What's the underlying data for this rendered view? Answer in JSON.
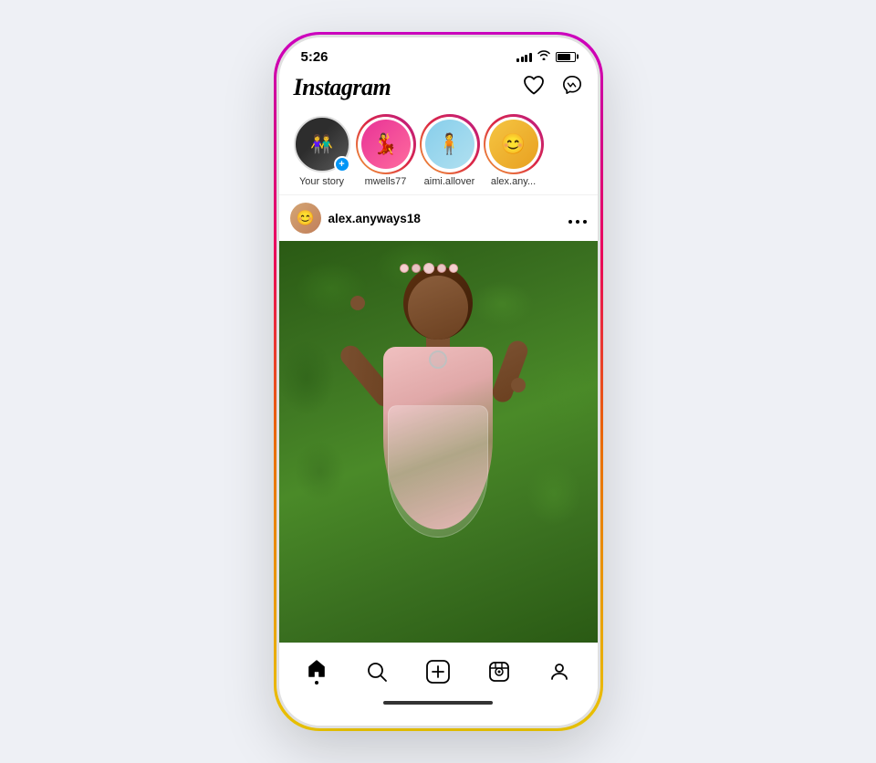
{
  "phone": {
    "status": {
      "time": "5:26"
    }
  },
  "header": {
    "logo": "Instagram",
    "heart_icon": "♡",
    "messenger_icon": "✉"
  },
  "stories": [
    {
      "id": "your-story",
      "label": "Your story",
      "has_add": true
    },
    {
      "id": "mwells77",
      "label": "mwells77",
      "has_add": false
    },
    {
      "id": "aimi-allover",
      "label": "aimi.allover",
      "has_add": false
    },
    {
      "id": "alex-anyways",
      "label": "alex.any...",
      "has_add": false
    }
  ],
  "post": {
    "username": "alex.anyways18",
    "options_icon": "···"
  },
  "nav": {
    "items": [
      {
        "id": "home",
        "icon": "⌂",
        "label": "Home",
        "active": true
      },
      {
        "id": "search",
        "icon": "⌕",
        "label": "Search",
        "active": false
      },
      {
        "id": "add",
        "icon": "⊕",
        "label": "Add",
        "active": false
      },
      {
        "id": "reels",
        "icon": "▶",
        "label": "Reels",
        "active": false
      },
      {
        "id": "profile",
        "icon": "◉",
        "label": "Profile",
        "active": false
      }
    ]
  }
}
